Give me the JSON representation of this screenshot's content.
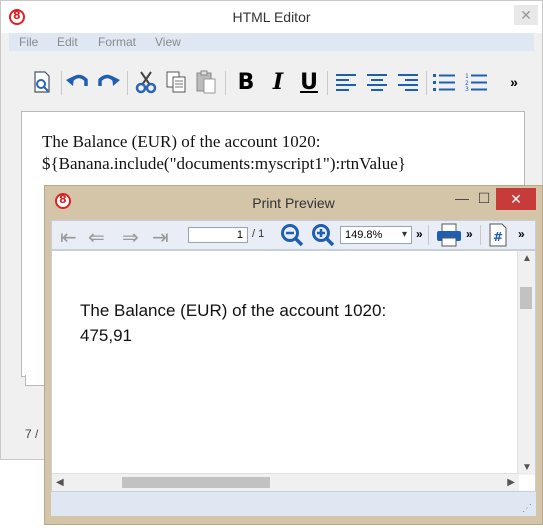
{
  "editor": {
    "title": "HTML Editor",
    "close_label": "✕",
    "menu": [
      "File",
      "Edit",
      "Format",
      "View"
    ],
    "content_line1": "The Balance (EUR) of the account 1020:",
    "content_line2": "${Banana.include(\"documents:myscript1\"):rtnValue}",
    "status": "7 /",
    "toolbar": {
      "bold_label": "B",
      "italic_label": "I",
      "underline_label": "U",
      "more_label": "»"
    }
  },
  "preview": {
    "title": "Print Preview",
    "minimize_label": "—",
    "maximize_label": "☐",
    "close_label": "✕",
    "page_current": "1",
    "page_total": "/ 1",
    "zoom": "149.8%",
    "more_label": "»",
    "line1": "The Balance (EUR) of the account 1020:",
    "line2": "475,91"
  }
}
